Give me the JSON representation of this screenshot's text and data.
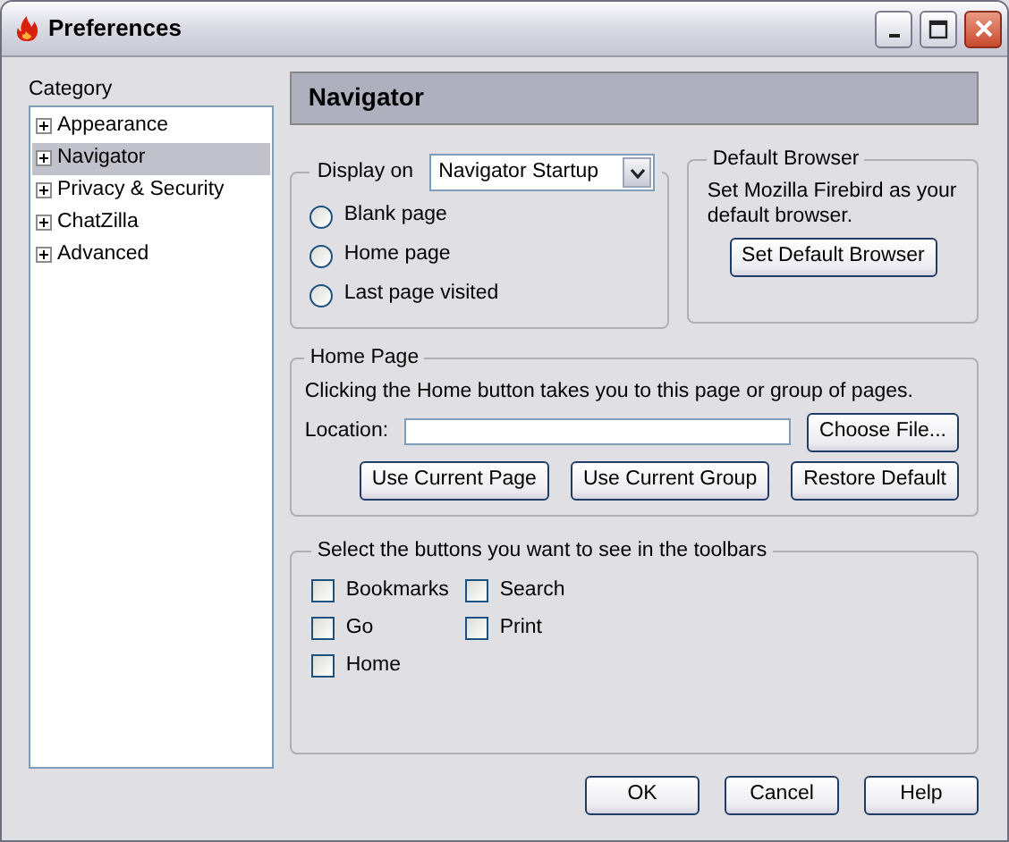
{
  "window": {
    "title": "Preferences"
  },
  "category": {
    "label": "Category",
    "items": [
      {
        "label": "Appearance",
        "selected": false,
        "expanded": false
      },
      {
        "label": "Navigator",
        "selected": true,
        "expanded": false
      },
      {
        "label": "Privacy & Security",
        "selected": false,
        "expanded": false
      },
      {
        "label": "ChatZilla",
        "selected": false,
        "expanded": false
      },
      {
        "label": "Advanced",
        "selected": false,
        "expanded": false
      }
    ]
  },
  "panel": {
    "title": "Navigator"
  },
  "display": {
    "label": "Display on",
    "value": "Navigator Startup",
    "options": [
      {
        "label": "Blank page",
        "selected": false
      },
      {
        "label": "Home page",
        "selected": false
      },
      {
        "label": "Last page visited",
        "selected": false
      }
    ]
  },
  "default_browser": {
    "title": "Default Browser",
    "text": "Set Mozilla Firebird as your default browser.",
    "button": "Set Default Browser"
  },
  "home_page": {
    "title": "Home Page",
    "text": "Clicking the Home button takes you to this page or group of pages.",
    "location_label": "Location:",
    "choose_button": "Choose File...",
    "buttons": [
      "Use Current Page",
      "Use Current Group",
      "Restore Default"
    ]
  },
  "toolbar_buttons": {
    "title": "Select the buttons you want to see in the toolbars",
    "items": [
      {
        "label": "Bookmarks",
        "checked": false
      },
      {
        "label": "Go",
        "checked": false
      },
      {
        "label": "Home",
        "checked": false
      },
      {
        "label": "Search",
        "checked": false
      },
      {
        "label": "Print",
        "checked": false
      }
    ]
  },
  "buttons": [
    "OK",
    "Cancel",
    "Help"
  ]
}
